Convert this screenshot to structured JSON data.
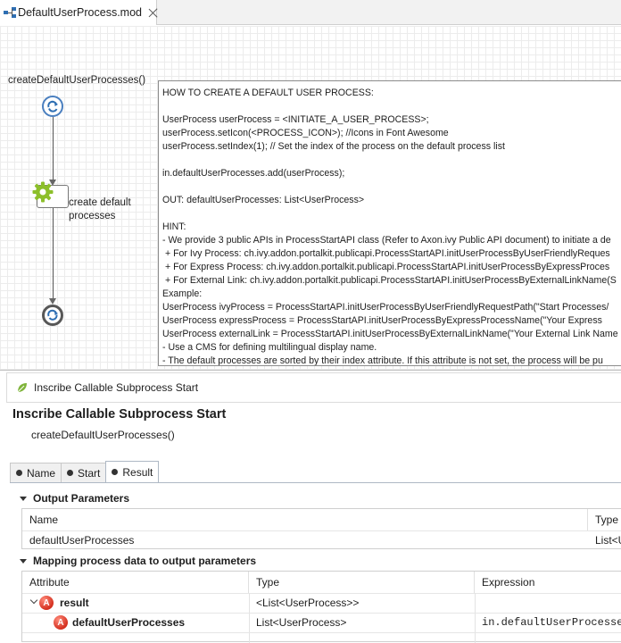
{
  "editor_tab": {
    "label": "DefaultUserProcess.mod",
    "icon": "process-model-icon",
    "close_icon": "close-icon"
  },
  "canvas": {
    "process_title": "createDefaultUserProcesses()",
    "task_label_line1": "create default",
    "task_label_line2": "processes",
    "note_lines": [
      "HOW TO CREATE A DEFAULT USER PROCESS:",
      "",
      "UserProcess userProcess = <INITIATE_A_USER_PROCESS>;",
      "userProcess.setIcon(<PROCESS_ICON>); //Icons in Font Awesome",
      "userProcess.setIndex(1); // Set the index of the process on the default process list",
      "",
      "in.defaultUserProcesses.add(userProcess);",
      "",
      "OUT: defaultUserProcesses: List<UserProcess>",
      "",
      "HINT:",
      "- We provide 3 public APIs in ProcessStartAPI class (Refer to Axon.ivy Public API document) to initiate a de",
      " + For Ivy Process: ch.ivy.addon.portalkit.publicapi.ProcessStartAPI.initUserProcessByUserFriendlyReques",
      " + For Express Process: ch.ivy.addon.portalkit.publicapi.ProcessStartAPI.initUserProcessByExpressProces",
      " + For External Link: ch.ivy.addon.portalkit.publicapi.ProcessStartAPI.initUserProcessByExternalLinkName(S",
      "Example:",
      "UserProcess ivyProcess = ProcessStartAPI.initUserProcessByUserFriendlyRequestPath(\"Start Processes/",
      "UserProcess expressProcess = ProcessStartAPI.initUserProcessByExpressProcessName(\"Your Express",
      "UserProcess externalLink = ProcessStartAPI.initUserProcessByExternalLinkName(\"Your External Link Name",
      "- Use a CMS for defining multilingual display name.",
      "- The default processes are sorted by their index attribute. If this attribute is not set, the process will be pu"
    ]
  },
  "dialog": {
    "window_title": "Inscribe Callable Subprocess Start",
    "heading": "Inscribe Callable Subprocess Start",
    "subtitle": "createDefaultUserProcesses()",
    "tabs": [
      {
        "label": "Name",
        "active": false
      },
      {
        "label": "Start",
        "active": false
      },
      {
        "label": "Result",
        "active": true
      }
    ],
    "output_section": {
      "title": "Output Parameters",
      "columns": [
        "Name",
        "Type"
      ],
      "rows": [
        {
          "name": "defaultUserProcesses",
          "type": "List<U"
        }
      ]
    },
    "mapping_section": {
      "title": "Mapping process data to output parameters",
      "columns": [
        "Attribute",
        "Type",
        "Expression"
      ],
      "rows": [
        {
          "attribute": "result",
          "type": "<List<UserProcess>>",
          "expression": ""
        },
        {
          "attribute": "defaultUserProcesses",
          "type": "List<UserProcess>",
          "expression": "in.defaultUserProcesses"
        }
      ]
    }
  },
  "colors": {
    "start_node": "#4a7fbf",
    "gear": "#8cbf2a",
    "attribute_icon": "#d4301f"
  }
}
